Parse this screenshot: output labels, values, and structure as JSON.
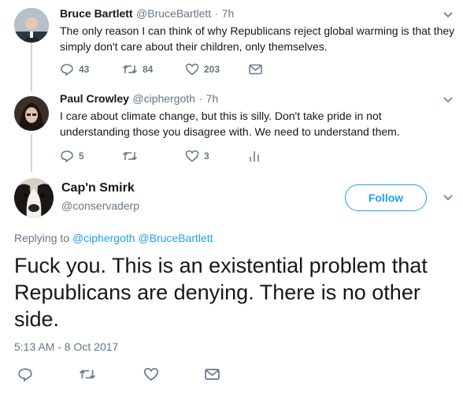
{
  "tweets": [
    {
      "name": "Bruce Bartlett",
      "handle": "@BruceBartlett",
      "time": "7h",
      "text_line1": "The only reason I can think of why Republicans reject global warming is that they",
      "text_line2": "simply don't care about their children, only themselves.",
      "replies": "43",
      "retweets": "84",
      "likes": "203"
    },
    {
      "name": "Paul Crowley",
      "handle": "@ciphergoth",
      "time": "7h",
      "text_line1": "I care about climate change, but this is silly. Don't take pride in not",
      "text_line2": "understanding those you disagree with. We need to understand them.",
      "replies": "5",
      "likes": "3"
    }
  ],
  "main": {
    "name": "Cap'n Smirk",
    "handle": "@conservaderp",
    "follow_label": "Follow",
    "replying_prefix": "Replying to",
    "replying_to_1": "@ciphergoth",
    "replying_to_2": "@BruceBartlett",
    "text_line1": "Fuck you. This is an existential problem that",
    "text_line2": "Republicans are denying. There is no other",
    "text_line3": "side.",
    "timestamp": "5:13 AM - 8 Oct 2017"
  },
  "colors": {
    "accent": "#1da1f2",
    "muted": "#657786",
    "thread": "#ccd6dd"
  }
}
